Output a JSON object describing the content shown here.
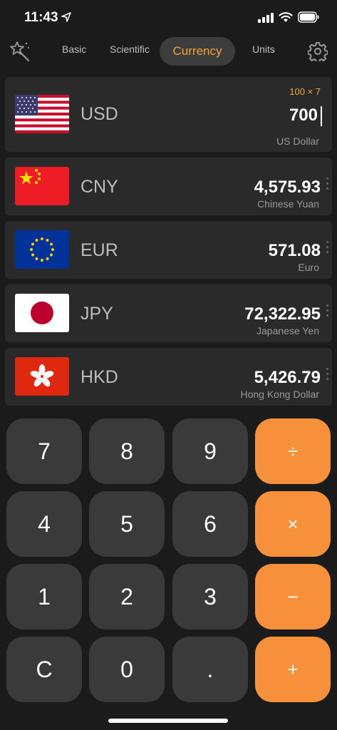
{
  "status": {
    "time": "11:43"
  },
  "nav": {
    "tabs": [
      "Basic",
      "Scientific",
      "Currency",
      "Units"
    ],
    "active": "Currency"
  },
  "base": {
    "code": "USD",
    "name": "US Dollar",
    "expression": "100 × 7",
    "value": "700"
  },
  "rows": [
    {
      "code": "CNY",
      "value": "4,575.93",
      "name": "Chinese Yuan"
    },
    {
      "code": "EUR",
      "value": "571.08",
      "name": "Euro"
    },
    {
      "code": "JPY",
      "value": "72,322.95",
      "name": "Japanese Yen"
    },
    {
      "code": "HKD",
      "value": "5,426.79",
      "name": "Hong Kong Dollar"
    }
  ],
  "keys": [
    "7",
    "8",
    "9",
    "÷",
    "4",
    "5",
    "6",
    "×",
    "1",
    "2",
    "3",
    "−",
    "C",
    "0",
    ".",
    "+"
  ],
  "colors": {
    "accent": "#f6a23c",
    "operator": "#f7903a",
    "key": "#3a3a3a",
    "row": "#2a2a2a"
  },
  "icons": [
    "location-arrow-icon",
    "signal-icon",
    "wifi-icon",
    "battery-icon",
    "magic-wand-icon",
    "gear-icon"
  ]
}
